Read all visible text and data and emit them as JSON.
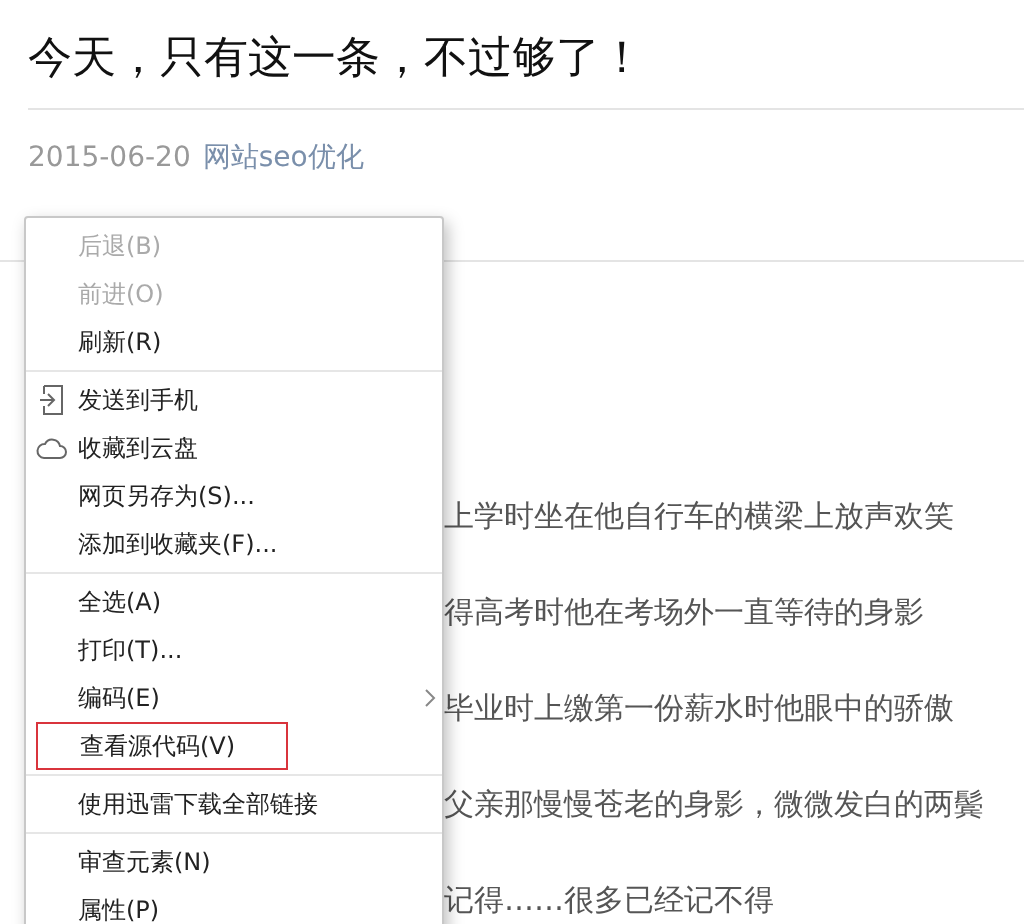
{
  "article": {
    "title": "今天，只有这一条，不过够了！",
    "date": "2015-06-20",
    "category": "网站seo优化",
    "paragraphs": [
      "上学时坐在他自行车的横梁上放声欢笑",
      "得高考时他在考场外一直等待的身影",
      "毕业时上缴第一份薪水时他眼中的骄傲",
      "父亲那慢慢苍老的身影，微微发白的两鬓",
      "记得……很多已经记不得"
    ]
  },
  "context_menu": {
    "groups": [
      [
        {
          "label": "后退(B)",
          "disabled": true
        },
        {
          "label": "前进(O)",
          "disabled": true
        },
        {
          "label": "刷新(R)",
          "disabled": false
        }
      ],
      [
        {
          "label": "发送到手机",
          "disabled": false,
          "kind": "phone"
        },
        {
          "label": "收藏到云盘",
          "disabled": false,
          "kind": "cloud"
        },
        {
          "label": "网页另存为(S)...",
          "disabled": false
        },
        {
          "label": "添加到收藏夹(F)...",
          "disabled": false
        }
      ],
      [
        {
          "label": "全选(A)",
          "disabled": false
        },
        {
          "label": "打印(T)...",
          "disabled": false
        },
        {
          "label": "编码(E)",
          "disabled": false,
          "submenu": true
        },
        {
          "label": "查看源代码(V)",
          "disabled": false,
          "highlighted": true
        }
      ],
      [
        {
          "label": "使用迅雷下载全部链接",
          "disabled": false
        }
      ],
      [
        {
          "label": "审查元素(N)",
          "disabled": false
        },
        {
          "label": "属性(P)",
          "disabled": false
        }
      ]
    ]
  }
}
